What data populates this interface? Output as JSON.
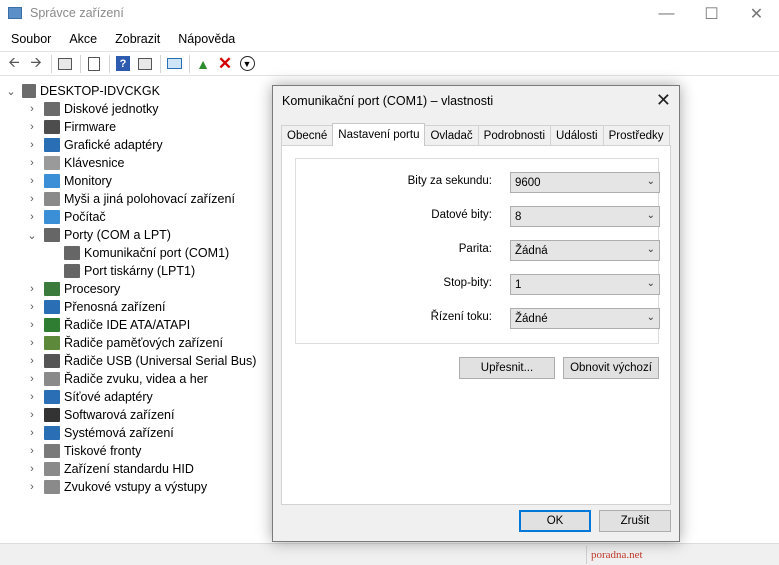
{
  "window": {
    "title": "Správce zařízení"
  },
  "menu": [
    "Soubor",
    "Akce",
    "Zobrazit",
    "Nápověda"
  ],
  "toolbar": {
    "icons": [
      "back-icon",
      "forward-icon",
      "properties-view-icon",
      "device-list-icon",
      "help-icon",
      "action-view-icon",
      "scan-monitor-icon",
      "update-driver-icon",
      "uninstall-icon",
      "download-icon"
    ]
  },
  "tree": {
    "root": "DESKTOP-IDVCKGK",
    "items": [
      {
        "label": "Diskové jednotky",
        "color": "#6b6b6b"
      },
      {
        "label": "Firmware",
        "color": "#4d4d4d"
      },
      {
        "label": "Grafické adaptéry",
        "color": "#2a6fb5"
      },
      {
        "label": "Klávesnice",
        "color": "#9a9a9a"
      },
      {
        "label": "Monitory",
        "color": "#3b8fd6"
      },
      {
        "label": "Myši a jiná polohovací zařízení",
        "color": "#8a8a8a"
      },
      {
        "label": "Počítač",
        "color": "#3b8fd6"
      },
      {
        "label": "Porty (COM a LPT)",
        "color": "#666666"
      },
      {
        "label": "Komunikační port (COM1)",
        "color": "#666666"
      },
      {
        "label": "Port tiskárny (LPT1)",
        "color": "#666666"
      },
      {
        "label": "Procesory",
        "color": "#3a7a3a"
      },
      {
        "label": "Přenosná zařízení",
        "color": "#2a6fb5"
      },
      {
        "label": "Řadiče IDE ATA/ATAPI",
        "color": "#2f7d32"
      },
      {
        "label": "Řadiče paměťových zařízení",
        "color": "#5c8a3a"
      },
      {
        "label": "Řadiče USB (Universal Serial Bus)",
        "color": "#555555"
      },
      {
        "label": "Řadiče zvuku, videa a her",
        "color": "#8a8a8a"
      },
      {
        "label": "Síťové adaptéry",
        "color": "#2a6fb5"
      },
      {
        "label": "Softwarová zařízení",
        "color": "#333333"
      },
      {
        "label": "Systémová zařízení",
        "color": "#2a6fb5"
      },
      {
        "label": "Tiskové fronty",
        "color": "#7a7a7a"
      },
      {
        "label": "Zařízení standardu HID",
        "color": "#8a8a8a"
      },
      {
        "label": "Zvukové vstupy a výstupy",
        "color": "#8a8a8a"
      }
    ]
  },
  "dialog": {
    "title": "Komunikační port (COM1) – vlastnosti",
    "tabs": [
      "Obecné",
      "Nastavení portu",
      "Ovladač",
      "Podrobnosti",
      "Události",
      "Prostředky"
    ],
    "active_tab": "Nastavení portu",
    "fields": [
      {
        "label": "Bity za sekundu:",
        "value": "9600"
      },
      {
        "label": "Datové bity:",
        "value": "8"
      },
      {
        "label": "Parita:",
        "value": "Žádná"
      },
      {
        "label": "Stop-bity:",
        "value": "1"
      },
      {
        "label": "Řízení toku:",
        "value": "Žádné"
      }
    ],
    "advanced_button": "Upřesnit...",
    "restore_button": "Obnovit výchozí",
    "ok_button": "OK",
    "cancel_button": "Zrušit"
  },
  "status": {
    "watermark": "poradna.net"
  }
}
